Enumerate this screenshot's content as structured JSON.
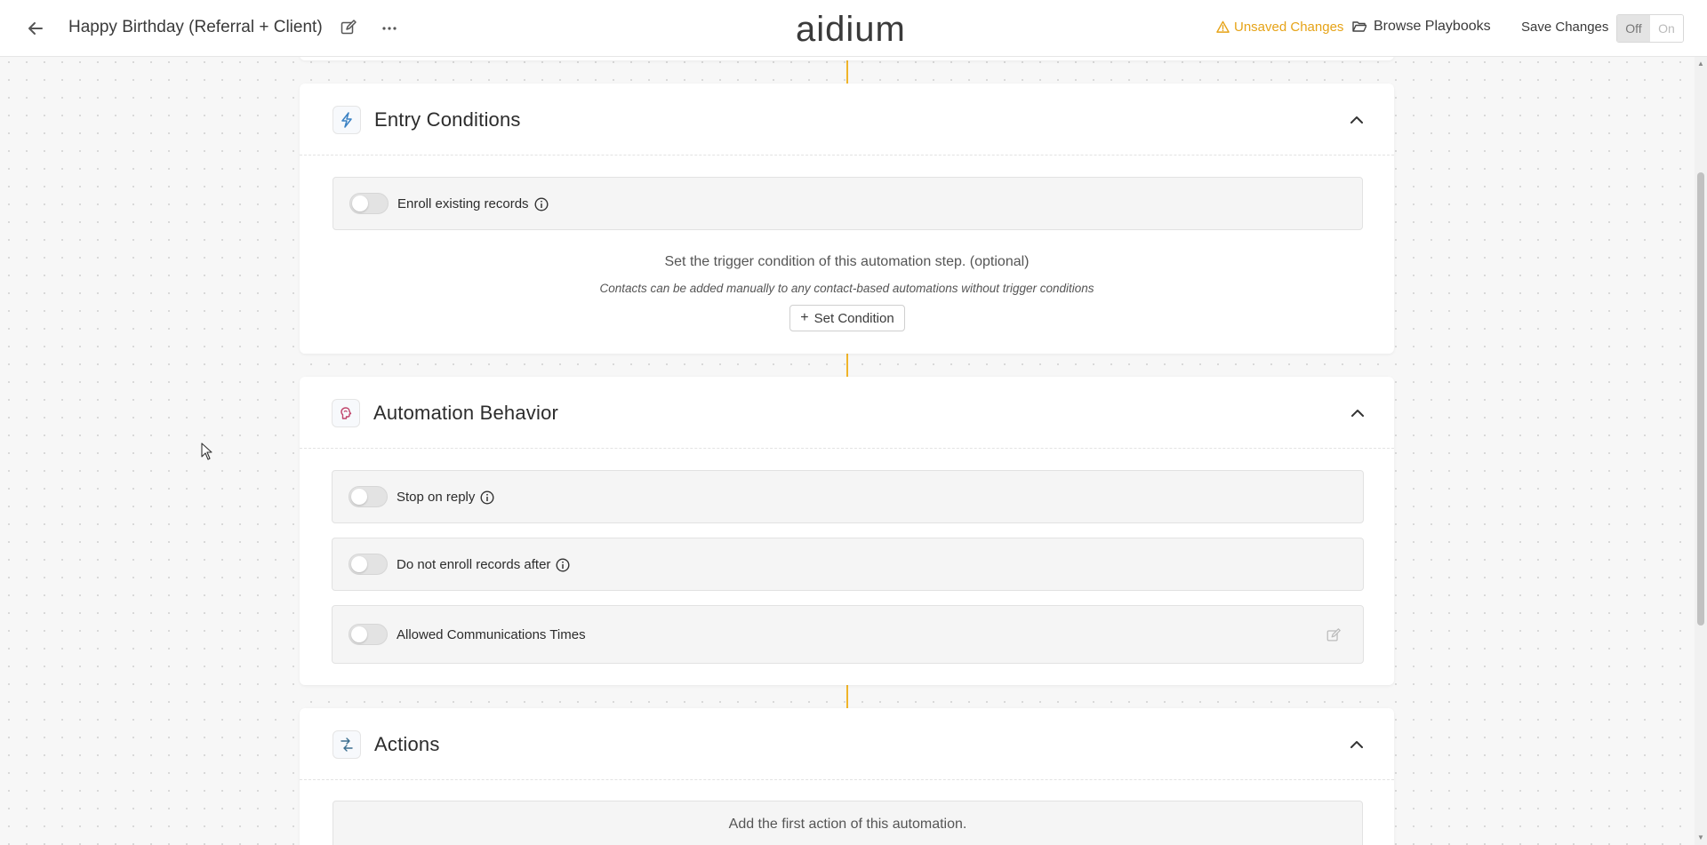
{
  "header": {
    "title": "Happy Birthday (Referral + Client)",
    "logo_text": "aidium",
    "unsaved_label": "Unsaved Changes",
    "browse_label": "Browse Playbooks",
    "save_label": "Save Changes",
    "toggle_off": "Off",
    "toggle_on": "On",
    "active_state": "Off"
  },
  "entry_conditions": {
    "title": "Entry Conditions",
    "icon": "lightning-icon",
    "enroll_existing_label": "Enroll existing records",
    "trigger_text": "Set the trigger condition of this automation step. (optional)",
    "trigger_subtext": "Contacts can be added manually to any contact-based automations without trigger conditions",
    "set_condition_label": "Set Condition"
  },
  "automation_behavior": {
    "title": "Automation Behavior",
    "icon": "brain-icon",
    "options": [
      {
        "label": "Stop on reply",
        "has_info": true
      },
      {
        "label": "Do not enroll records after",
        "has_info": true
      },
      {
        "label": "Allowed Communications Times",
        "has_edit": true
      }
    ]
  },
  "actions": {
    "title": "Actions",
    "icon": "flow-icon",
    "empty_text": "Add the first action of this automation."
  },
  "colors": {
    "accent_warning": "#e6a317",
    "connector": "#f0b429"
  }
}
